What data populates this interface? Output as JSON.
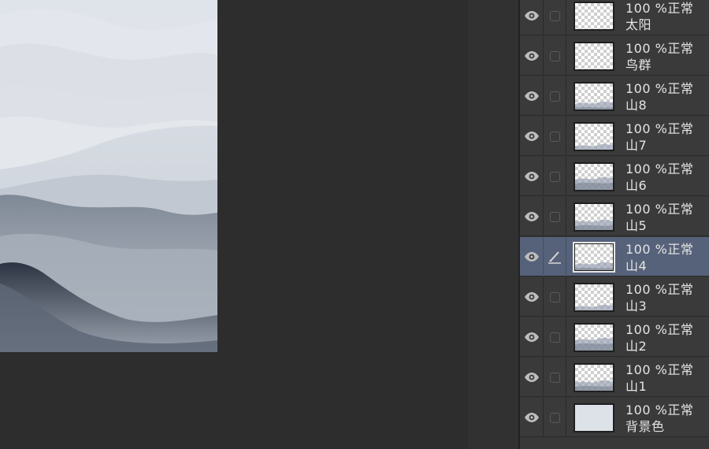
{
  "layers": [
    {
      "name": "太阳",
      "opacity": "100 %",
      "blend": "正常",
      "selected": false,
      "icon": "checkbox",
      "thumb": "transparent"
    },
    {
      "name": "鸟群",
      "opacity": "100 %",
      "blend": "正常",
      "selected": false,
      "icon": "checkbox",
      "thumb": "transparent"
    },
    {
      "name": "山8",
      "opacity": "100 %",
      "blend": "正常",
      "selected": false,
      "icon": "checkbox",
      "thumb": "mountain"
    },
    {
      "name": "山7",
      "opacity": "100 %",
      "blend": "正常",
      "selected": false,
      "icon": "checkbox",
      "thumb": "mountain"
    },
    {
      "name": "山6",
      "opacity": "100 %",
      "blend": "正常",
      "selected": false,
      "icon": "checkbox",
      "thumb": "mountain"
    },
    {
      "name": "山5",
      "opacity": "100 %",
      "blend": "正常",
      "selected": false,
      "icon": "checkbox",
      "thumb": "mountain"
    },
    {
      "name": "山4",
      "opacity": "100 %",
      "blend": "正常",
      "selected": true,
      "icon": "brush-icon",
      "thumb": "mountain"
    },
    {
      "name": "山3",
      "opacity": "100 %",
      "blend": "正常",
      "selected": false,
      "icon": "checkbox",
      "thumb": "mountain"
    },
    {
      "name": "山2",
      "opacity": "100 %",
      "blend": "正常",
      "selected": false,
      "icon": "checkbox",
      "thumb": "mountain"
    },
    {
      "name": "山1",
      "opacity": "100 %",
      "blend": "正常",
      "selected": false,
      "icon": "checkbox",
      "thumb": "mountain"
    },
    {
      "name": "背景色",
      "opacity": "100 %",
      "blend": "正常",
      "selected": false,
      "icon": "checkbox",
      "thumb": "solid"
    }
  ],
  "colors": {
    "panel_bg": "#3a3a3a",
    "selected_row": "#56627a",
    "canvas_bg": "#2d2d2d",
    "text": "#e4e4e4"
  }
}
